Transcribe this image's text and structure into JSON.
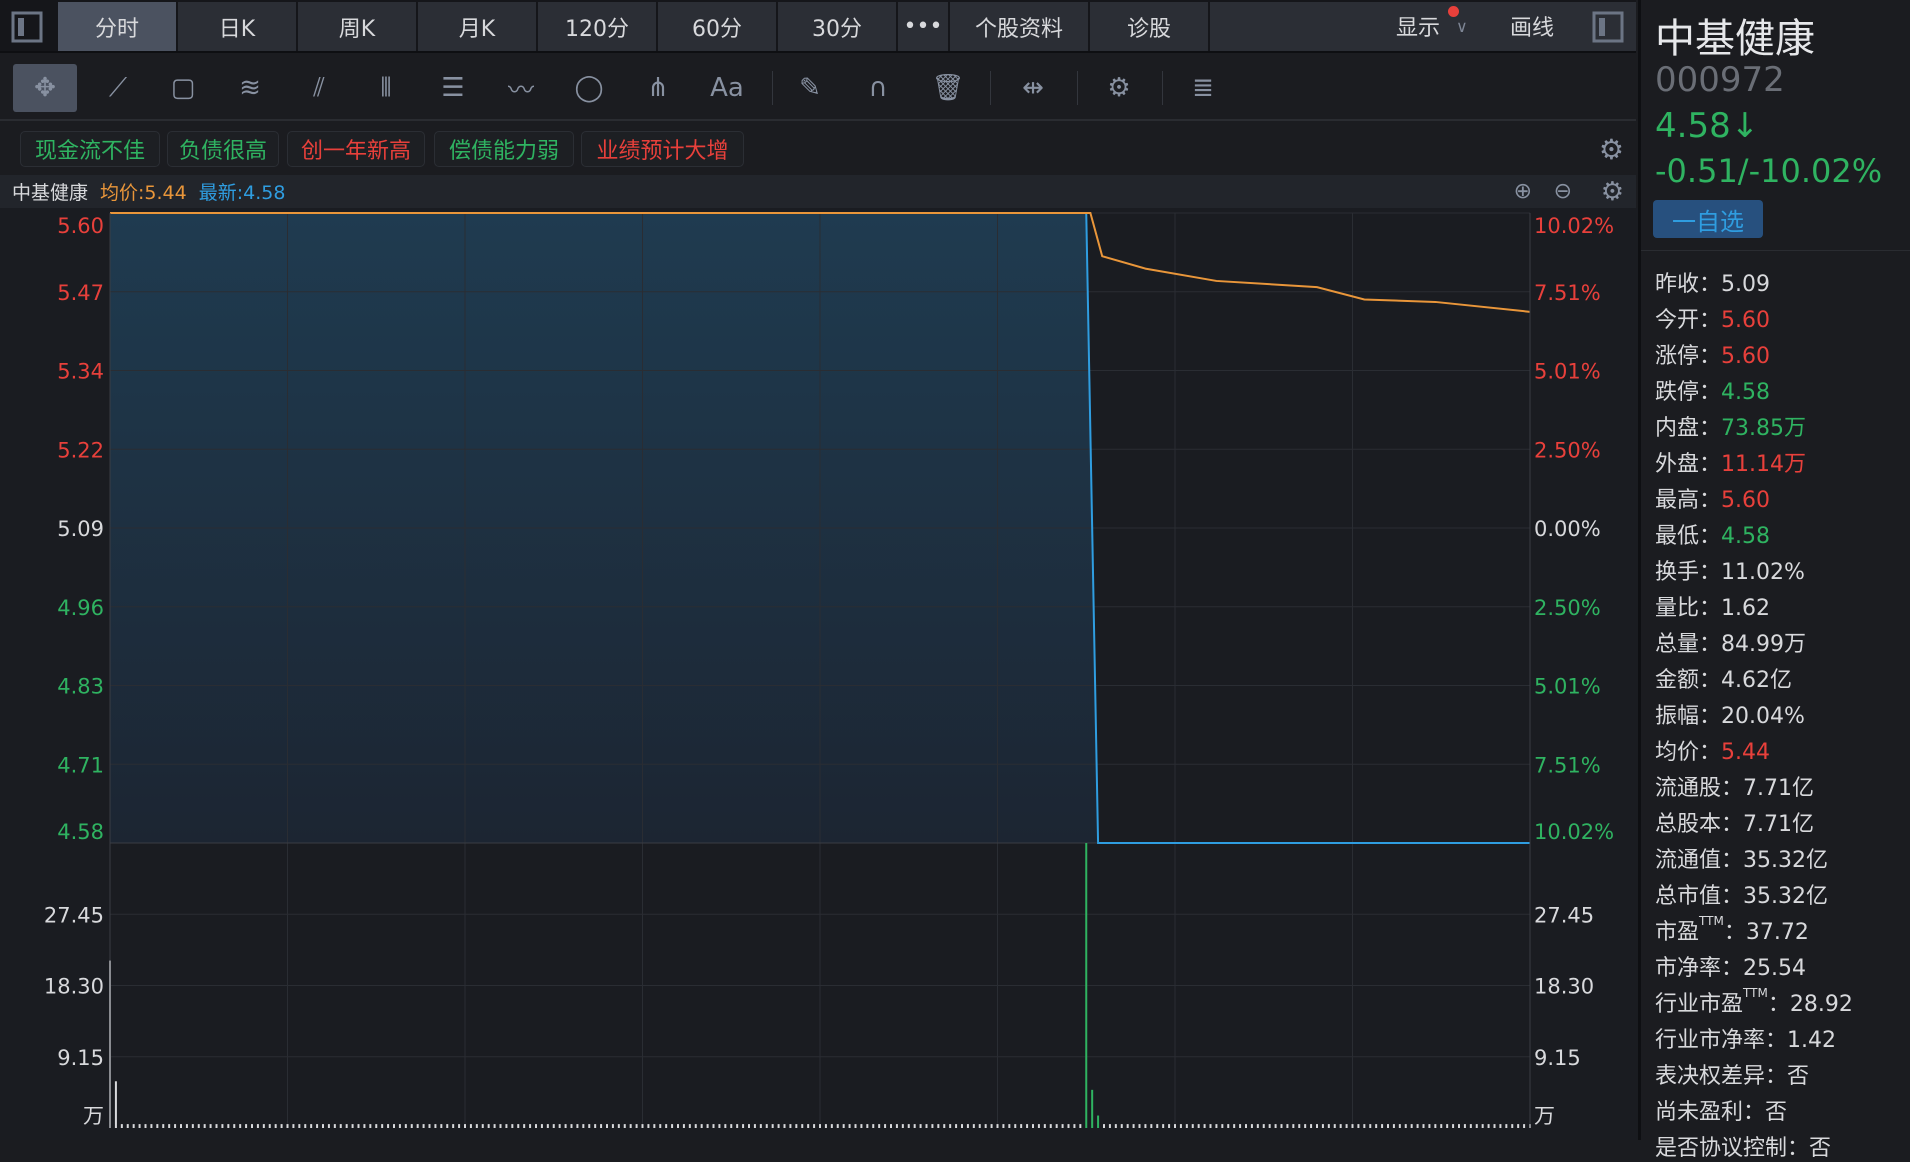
{
  "tabs": [
    "分时",
    "日K",
    "周K",
    "月K",
    "120分",
    "60分",
    "30分"
  ],
  "more_label": "•••",
  "extra_tabs": [
    "个股资料",
    "诊股"
  ],
  "display_label": "显示",
  "draw_label": "画线",
  "toolbar_icons": [
    "move-icon",
    "line-segment-icon",
    "rectangle-icon",
    "fan-icon",
    "channel-icon",
    "vertical-lines-icon",
    "gann-icon",
    "wave-icon",
    "ellipse-icon",
    "pitchfork-icon",
    "text-icon",
    "eraser-icon",
    "magnet-icon",
    "trash-icon",
    "fit-width-icon",
    "settings-icon",
    "layers-icon"
  ],
  "text_tool_label": "Aa",
  "tags": [
    {
      "label": "现金流不佳",
      "color": "#2fb361"
    },
    {
      "label": "负债很高",
      "color": "#2fb361"
    },
    {
      "label": "创一年新高",
      "color": "#e8403b"
    },
    {
      "label": "偿债能力弱",
      "color": "#2fb361"
    },
    {
      "label": "业绩预计大增",
      "color": "#e8403b"
    }
  ],
  "chart_header": {
    "name": "中基健康",
    "avg": "均价:5.44",
    "latest": "最新:4.58"
  },
  "stock": {
    "name": "中基健康",
    "code": "000972",
    "price": "4.58↓",
    "change": "-0.51/-10.02%",
    "watch_button": "一自选"
  },
  "stats": [
    {
      "label": "昨收：",
      "value": "5.09",
      "color": ""
    },
    {
      "label": "今开：",
      "value": "5.60",
      "color": "red"
    },
    {
      "label": "涨停：",
      "value": "5.60",
      "color": "red"
    },
    {
      "label": "跌停：",
      "value": "4.58",
      "color": "green"
    },
    {
      "label": "内盘：",
      "value": "73.85万",
      "color": "green"
    },
    {
      "label": "外盘：",
      "value": "11.14万",
      "color": "red"
    },
    {
      "label": "最高：",
      "value": "5.60",
      "color": "red"
    },
    {
      "label": "最低：",
      "value": "4.58",
      "color": "green"
    },
    {
      "label": "换手：",
      "value": "11.02%",
      "color": ""
    },
    {
      "label": "量比：",
      "value": "1.62",
      "color": ""
    },
    {
      "label": "总量：",
      "value": "84.99万",
      "color": ""
    },
    {
      "label": "金额：",
      "value": "4.62亿",
      "color": ""
    },
    {
      "label": "振幅：",
      "value": "20.04%",
      "color": ""
    },
    {
      "label": "均价：",
      "value": "5.44",
      "color": "red"
    },
    {
      "label": "流通股：",
      "value": "7.71亿",
      "color": ""
    },
    {
      "label": "总股本：",
      "value": "7.71亿",
      "color": ""
    },
    {
      "label": "流通值：",
      "value": "35.32亿",
      "color": ""
    },
    {
      "label": "总市值：",
      "value": "35.32亿",
      "color": ""
    },
    {
      "label": "市盈",
      "sup": "TTM",
      "label2": "：",
      "value": "37.72",
      "color": ""
    },
    {
      "label": "市净率：",
      "value": "25.54",
      "color": ""
    },
    {
      "label": "行业市盈",
      "sup": "TTM",
      "label2": "：",
      "value": "28.92",
      "color": ""
    },
    {
      "label": "行业市净率：",
      "value": "1.42",
      "color": ""
    },
    {
      "label": "表决权差异：",
      "value": "否",
      "color": ""
    },
    {
      "label": "尚未盈利：",
      "value": "否",
      "color": ""
    },
    {
      "label": "是否协议控制：",
      "value": "否",
      "color": ""
    }
  ],
  "chart_data": {
    "type": "line",
    "title": "中基健康 分时",
    "price_axis": {
      "min": 4.58,
      "max": 5.6,
      "ticks": [
        "5.60",
        "5.47",
        "5.34",
        "5.22",
        "5.09",
        "4.96",
        "4.83",
        "4.71",
        "4.58"
      ]
    },
    "pct_ticks": [
      "10.02%",
      "7.51%",
      "5.01%",
      "2.50%",
      "0.00%",
      "2.50%",
      "5.01%",
      "7.51%",
      "10.02%"
    ],
    "prev_close": 5.09,
    "minutes_total": 240,
    "price_series": [
      [
        0,
        5.6
      ],
      [
        165,
        5.6
      ],
      [
        167,
        4.58
      ],
      [
        240,
        4.58
      ]
    ],
    "avg_series": [
      [
        0,
        5.6
      ],
      [
        165,
        5.6
      ],
      [
        165.7,
        5.6
      ],
      [
        167.7,
        5.53
      ],
      [
        175,
        5.51
      ],
      [
        187,
        5.49
      ],
      [
        204,
        5.48
      ],
      [
        212,
        5.46
      ],
      [
        224,
        5.456
      ],
      [
        240,
        5.44
      ]
    ],
    "volume_axis": {
      "max": 36.6,
      "ticks": [
        "27.45",
        "18.30",
        "9.15"
      ],
      "unit": "万"
    },
    "volume_spikes": [
      [
        0,
        21.5,
        "up"
      ],
      [
        1,
        6.0,
        "up"
      ],
      [
        165,
        36.6,
        "down"
      ],
      [
        166,
        4.9,
        "down"
      ],
      [
        167,
        1.6,
        "down"
      ]
    ],
    "volume_base": 0.5,
    "colors": {
      "price": "#2f9de0",
      "avg": "#e9963a",
      "up": "#e8403b",
      "down": "#2fb361",
      "neutral": "#d8d9dc"
    }
  }
}
